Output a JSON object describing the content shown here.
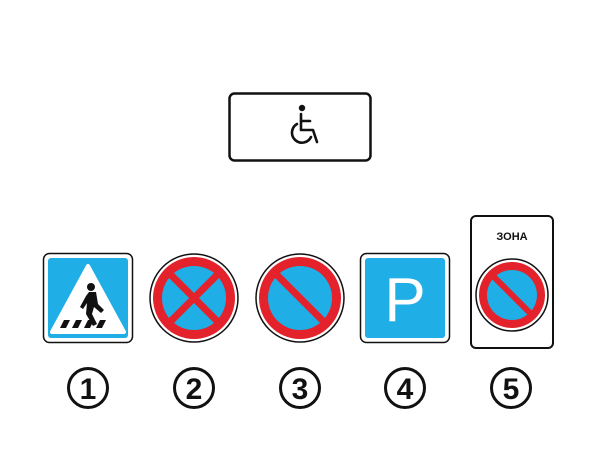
{
  "plate": {
    "icon": "wheelchair-icon"
  },
  "signs": [
    {
      "icon": "pedestrian-crossing-icon",
      "number": "1"
    },
    {
      "icon": "no-stopping-icon",
      "number": "2"
    },
    {
      "icon": "no-parking-icon",
      "number": "3"
    },
    {
      "icon": "parking-icon",
      "letter": "P",
      "number": "4"
    },
    {
      "icon": "no-parking-zone-icon",
      "zone_text": "ЗОНА",
      "number": "5"
    }
  ],
  "colors": {
    "blue": "#1faee6",
    "red": "#e3222b",
    "black": "#111111",
    "white": "#ffffff"
  }
}
